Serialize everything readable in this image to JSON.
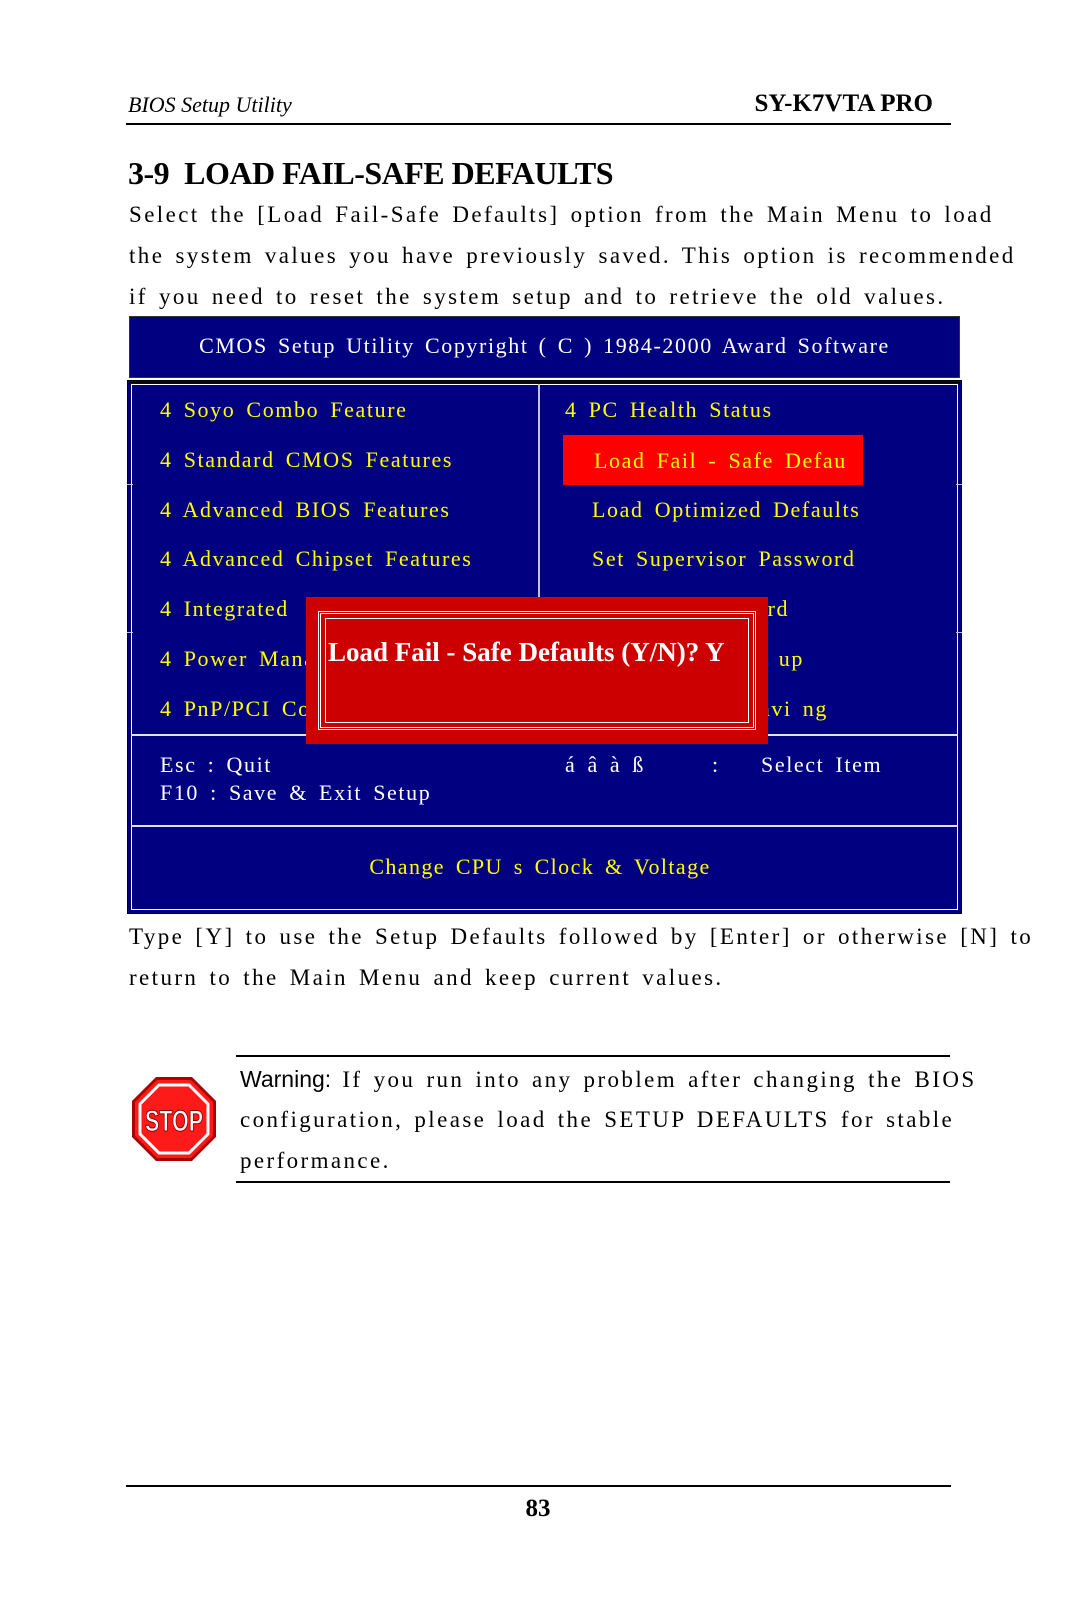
{
  "header": {
    "left": "BIOS Setup Utility",
    "right": "SY-K7VTA PRO"
  },
  "section": {
    "title": "3-9  LOAD FAIL-SAFE DEFAULTS",
    "intro_lines": [
      "Select the [Load Fail-Safe Defaults] option from the Main Menu to load",
      "the system values you have previously saved. This option is recommended",
      "if you need to reset the system setup and to retrieve the old values."
    ]
  },
  "bios": {
    "title": "CMOS Setup Utility Copyright ( C ) 1984-2000 Award Software",
    "left_menu": [
      "4 Soyo Combo Feature",
      "4 Standard CMOS Features",
      "4 Advanced BIOS Features",
      "4 Advanced Chipset Features",
      "4 Integrated",
      "4 Power Mana",
      "4 PnP/PCI Co"
    ],
    "right_menu": [
      "4 PC Health Status",
      "Load Fail - Safe Defau",
      "Load Optimized Defaults",
      "Set Supervisor Password",
      "ord",
      "t up",
      "avi ng"
    ],
    "selected_item": "Load Fail - Safe Defau",
    "footer": {
      "esc": "Esc : Quit",
      "f10": "F10 : Save & Exit Setup",
      "arrows": "á â à ß",
      "colon": ":",
      "select": "Select Item",
      "status": "Change CPU s Clock & Voltage"
    },
    "dialog": {
      "prompt": "Load Fail - Safe Defaults (Y/N)? Y"
    },
    "colors": {
      "background": "#000080",
      "menu_text": "#ffff00",
      "highlight": "#ff0000",
      "dialog": "#cc0000"
    }
  },
  "instructions": [
    "Type [Y] to use the Setup Defaults followed by [Enter] or otherwise [N] to",
    "return to the Main Menu and keep current values."
  ],
  "warning": {
    "icon": "stop-sign-icon",
    "label": "Warning:",
    "line1_rest": " If you run into any problem after changing the BIOS",
    "line2": "configuration, please load the SETUP DEFAULTS for stable",
    "line3": "performance."
  },
  "page_number": "83"
}
